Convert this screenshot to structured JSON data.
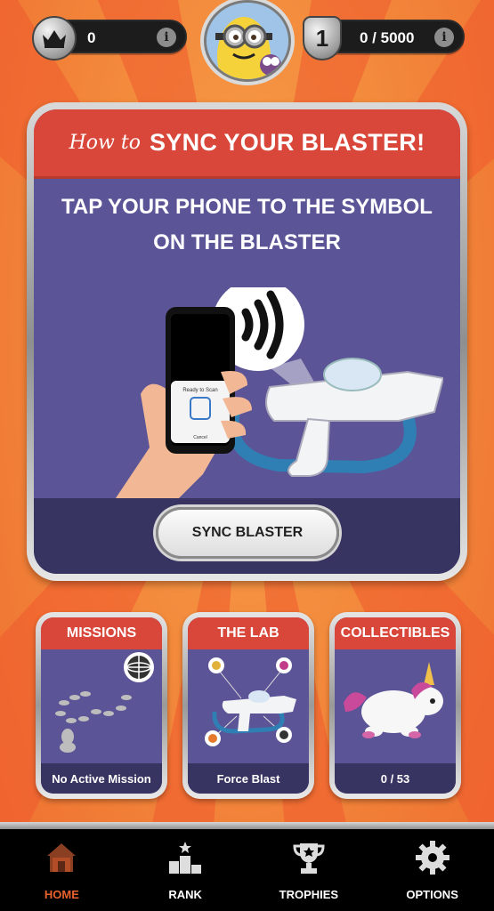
{
  "top_bar": {
    "crowns": {
      "value": "0",
      "icon": "crown-icon"
    },
    "rank": {
      "level": "1",
      "progress": "0 / 5000",
      "icon": "shield-icon"
    },
    "avatar": {
      "icon": "minion-avatar-icon"
    },
    "info_glyph": "i"
  },
  "sync_card": {
    "title_prefix": "How to",
    "title": "SYNC YOUR BLASTER!",
    "instruction": "TAP YOUR PHONE TO THE SYMBOL ON THE BLASTER",
    "phone_prompt": "Ready to Scan",
    "phone_cancel": "Cancel",
    "button_label": "SYNC BLASTER"
  },
  "cards": [
    {
      "title": "MISSIONS",
      "footer": "No Active Mission",
      "icon": "globe-icon"
    },
    {
      "title": "THE LAB",
      "footer": "Force Blast",
      "icon": "blaster-icon"
    },
    {
      "title": "COLLECTIBLES",
      "footer": "0 / 53",
      "icon": "unicorn-icon"
    }
  ],
  "nav": [
    {
      "label": "HOME",
      "icon": "house-icon",
      "active": true
    },
    {
      "label": "RANK",
      "icon": "podium-icon",
      "active": false
    },
    {
      "label": "TROPHIES",
      "icon": "trophy-icon",
      "active": false
    },
    {
      "label": "OPTIONS",
      "icon": "gear-icon",
      "active": false
    }
  ],
  "colors": {
    "accent_red": "#d8473a",
    "panel_purple": "#5b5496",
    "panel_dark": "#383461",
    "active_nav": "#e8622e",
    "background_orange": "#f38a3c"
  }
}
